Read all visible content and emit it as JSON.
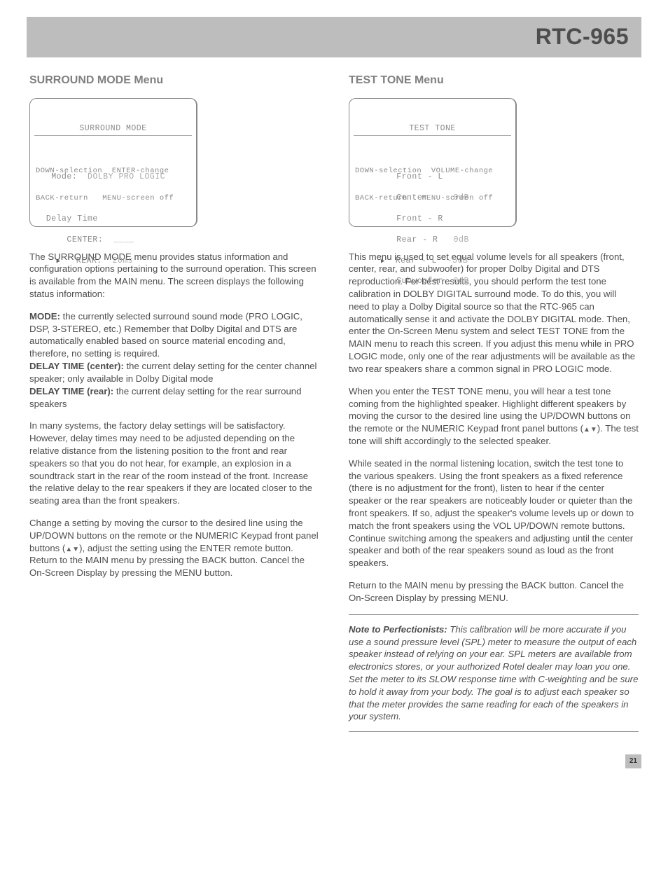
{
  "header": {
    "model": "RTC-965"
  },
  "left": {
    "heading": "SURROUND MODE Menu",
    "osd": {
      "title": "SURROUND MODE",
      "line_mode_label": "Mode:",
      "line_mode_value": "DOLBY PRO LOGIC",
      "line_delay": "Delay Time",
      "line_center_label": "CENTER:",
      "line_center_value": "____",
      "line_rear_label": "REAR:",
      "line_rear_value": "20ms",
      "hint1": "DOWN-selection  ENTER-change",
      "hint2": "BACK-return   MENU-screen off"
    },
    "p1": "The SURROUND MODE menu provides status information and configuration options pertaining to the surround operation. This screen is available from the MAIN menu. The screen displays the following status information:",
    "p2_label": "MODE:",
    "p2_text": " the currently selected surround sound mode (PRO LOGIC, DSP, 3-STEREO, etc.) Remember that Dolby Digital and DTS are automatically enabled based on source material encoding and, therefore, no setting is required.",
    "p3_label": "DELAY TIME (center):",
    "p3_text": " the current delay setting for the center channel speaker; only available in Dolby Digital mode",
    "p4_label": "DELAY TIME (rear):",
    "p4_text": " the current delay setting for the rear surround speakers",
    "p5": "In many systems, the factory delay settings will be satisfactory. However, delay times may need to be adjusted depending on the relative distance from the listening position to the front and rear speakers so that you do not hear, for example, an explosion in a soundtrack start in the rear of the room instead of the front. Increase the relative delay to the rear speakers if they are located closer to the seating area than the front speakers.",
    "p6a": "Change a setting by moving the cursor to the desired line using the UP/DOWN buttons on the remote or the NUMERIC Keypad front panel buttons (",
    "p6b": "), adjust the setting using the ENTER remote button. Return to the MAIN menu by pressing the BACK button. Cancel the On-Screen Display by pressing the MENU button."
  },
  "right": {
    "heading": "TEST TONE Menu",
    "osd": {
      "title": "TEST TONE",
      "r1": "Front - L",
      "r2l": "Center",
      "r2v": "0dB",
      "r3": "Front - R",
      "r4l": "Rear - R",
      "r4v": "0dB",
      "r5l": "Rear - L",
      "r5v": "-5dB",
      "r6l": "Subwoofer",
      "r6v": "0dB",
      "hint1": "DOWN-selection  VOLUME-change",
      "hint2": "BACK-return   MENU-screen off"
    },
    "p1": "This menu is used to set equal volume levels for all speakers (front, center, rear, and subwoofer) for proper Dolby Digital and DTS reproduction. For best results, you should perform the test tone calibration in DOLBY DIGITAL surround mode. To do this, you will need to play a Dolby Digital source so that the RTC-965 can automatically sense it and activate the DOLBY DIGITAL mode. Then, enter the On-Screen Menu system and select TEST TONE from the MAIN menu to reach this screen. If you adjust this menu while in PRO LOGIC mode, only one of the rear adjustments will be available as the two rear speakers share a common signal in PRO LOGIC mode.",
    "p2a": "When you enter the TEST TONE menu, you will hear a test tone coming from the highlighted speaker. Highlight different speakers by moving the cursor to the desired line using the UP/DOWN buttons on the remote or the NUMERIC Keypad front panel buttons (",
    "p2b": "). The test tone will shift accordingly to the selected speaker.",
    "p3": "While seated in the normal listening location, switch the test tone to the various speakers. Using the front speakers as a fixed reference (there is no adjustment for the front), listen to hear if the center speaker or the rear speakers are noticeably louder or quieter than the front speakers. If so, adjust the speaker's volume levels up or down to match the front speakers using the VOL UP/DOWN remote buttons. Continue switching among the speakers and adjusting until the center speaker and both of the rear speakers sound as loud as the front speakers.",
    "p4": "Return to the MAIN menu by pressing the BACK button. Cancel the On-Screen Display by pressing MENU.",
    "note_label": "Note to Perfectionists:",
    "note_text": " This calibration will be more accurate if you use a sound pressure level (SPL) meter to measure the output of each speaker instead of relying on your ear. SPL meters are available from electronics stores, or your authorized Rotel dealer may loan you one. Set the meter to its SLOW response time with C-weighting and be sure to hold it away from your body. The goal is to adjust each speaker so that the meter provides the same reading for each of the speakers in your system."
  },
  "page_number": "21"
}
